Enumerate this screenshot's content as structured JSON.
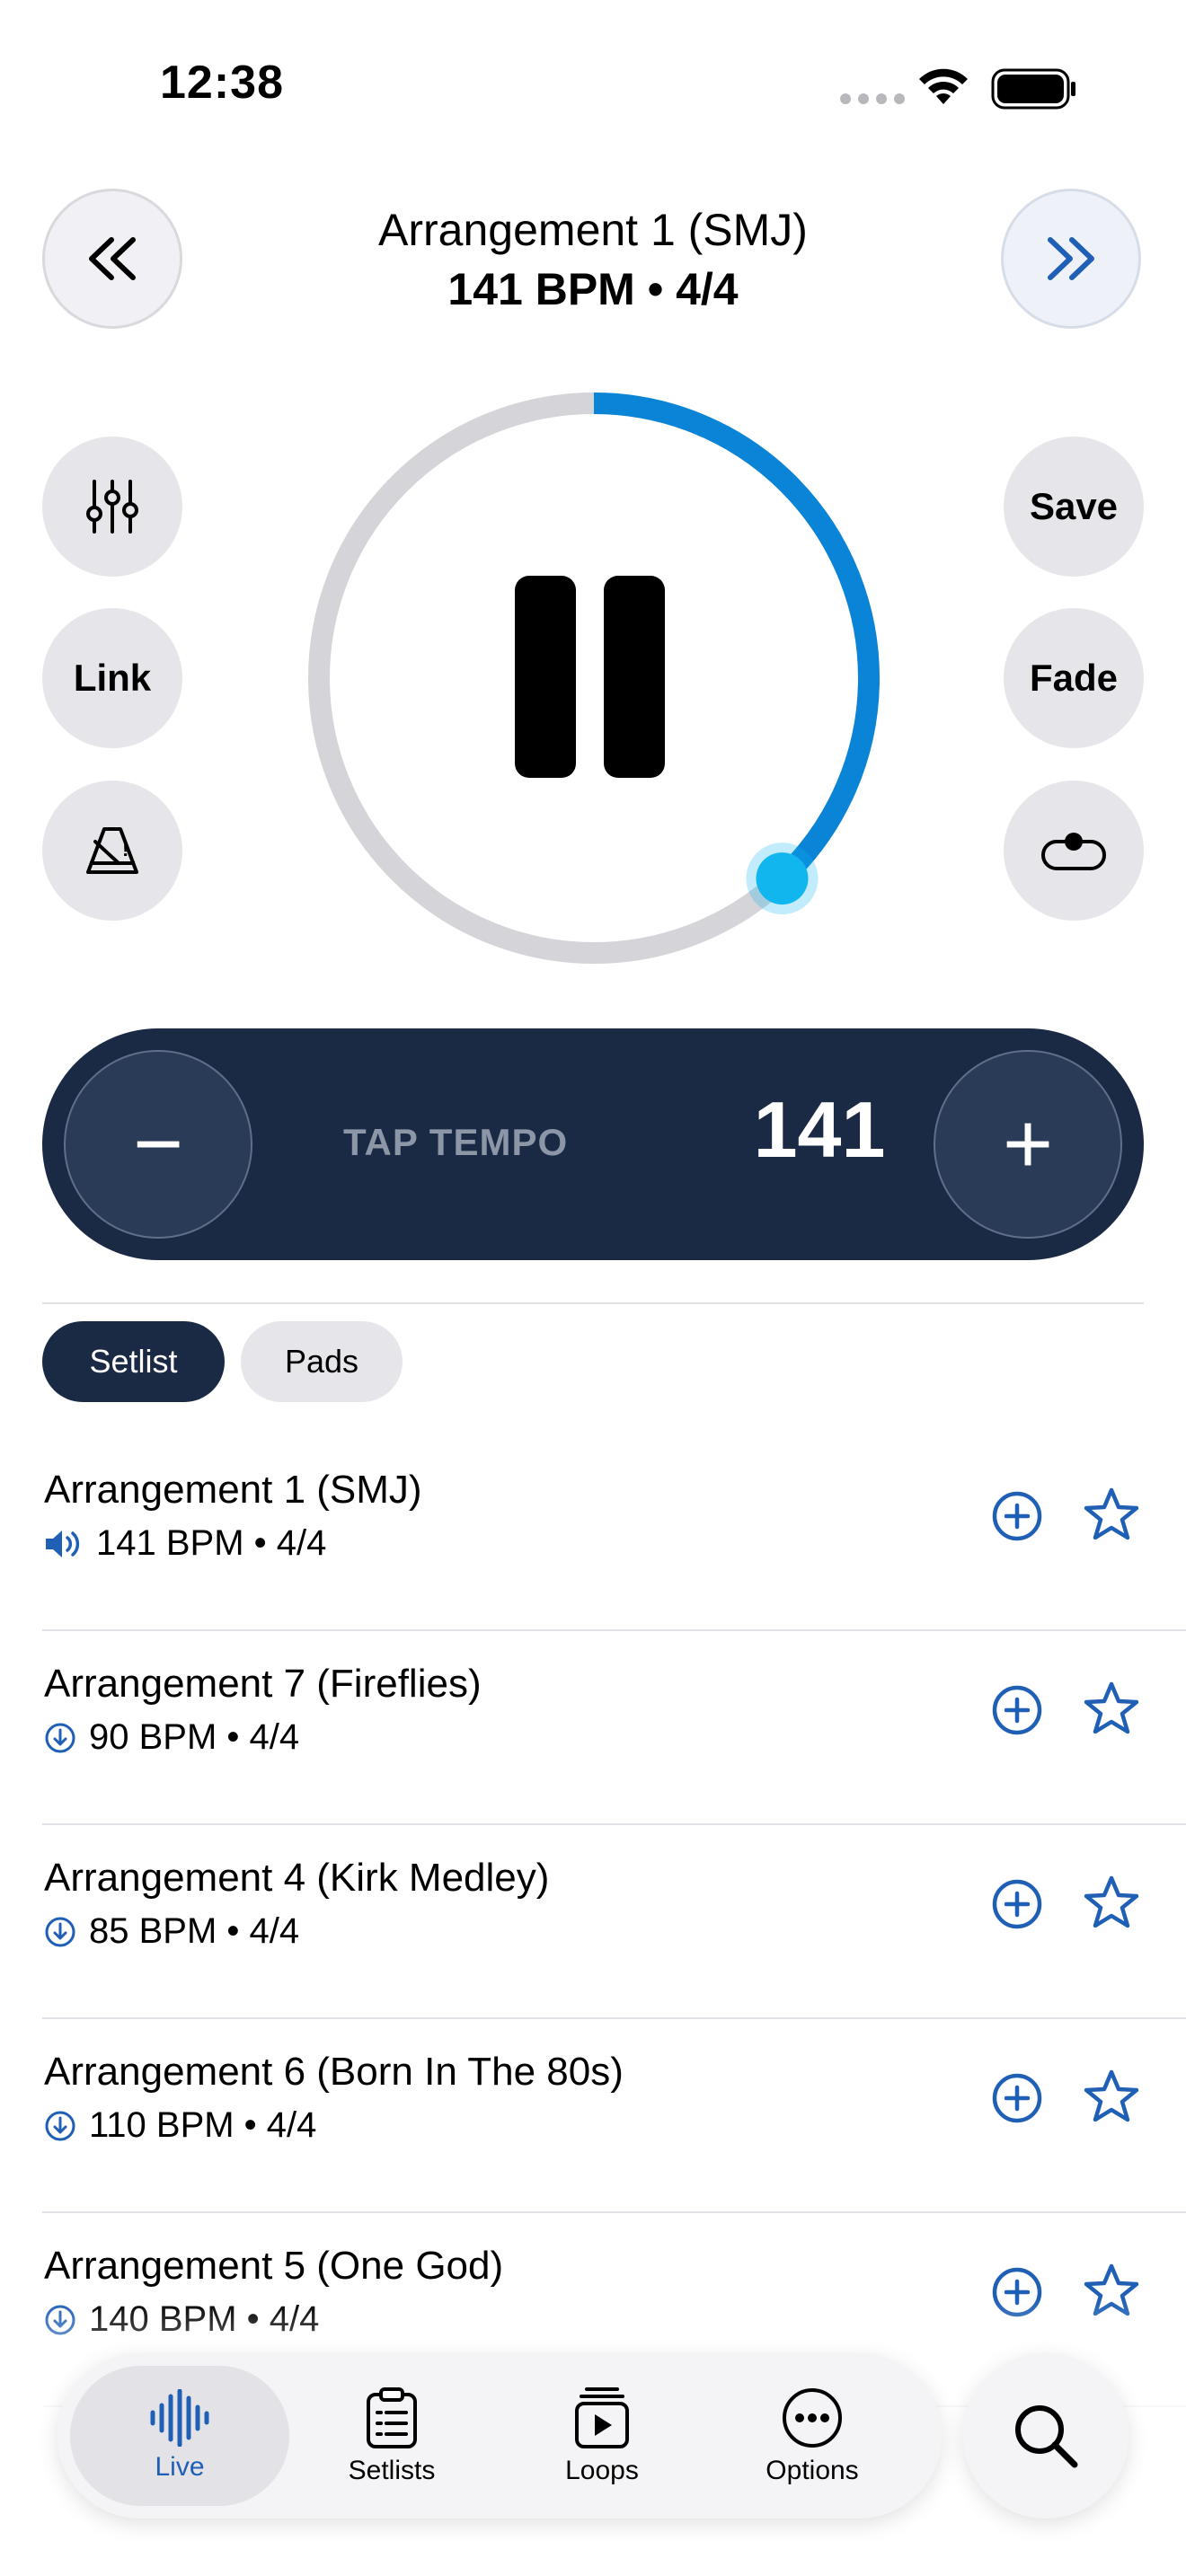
{
  "status_bar": {
    "time": "12:38"
  },
  "header": {
    "song_title": "Arrangement 1 (SMJ)",
    "song_meta": "141 BPM • 4/4"
  },
  "side_buttons": {
    "link_label": "Link",
    "save_label": "Save",
    "fade_label": "Fade"
  },
  "player": {
    "state": "playing",
    "progress": 0.38
  },
  "tempo": {
    "tap_label": "TAP TEMPO",
    "bpm": "141",
    "minus_symbol": "−",
    "plus_symbol": "+"
  },
  "segments": {
    "setlist": "Setlist",
    "pads": "Pads",
    "selected": "Setlist"
  },
  "setlist": [
    {
      "title": "Arrangement 1 (SMJ)",
      "meta": "141 BPM • 4/4",
      "status_icon": "speaker-icon"
    },
    {
      "title": "Arrangement 7 (Fireflies)",
      "meta": "90 BPM • 4/4",
      "status_icon": "download-icon"
    },
    {
      "title": "Arrangement 4 (Kirk Medley)",
      "meta": "85 BPM • 4/4",
      "status_icon": "download-icon"
    },
    {
      "title": "Arrangement 6 (Born In The 80s)",
      "meta": "110 BPM • 4/4",
      "status_icon": "download-icon"
    },
    {
      "title": "Arrangement 5 (One God)",
      "meta": "140 BPM • 4/4",
      "status_icon": "download-icon"
    }
  ],
  "tabbar": {
    "live": "Live",
    "setlists": "Setlists",
    "loops": "Loops",
    "options": "Options",
    "selected": "Live"
  },
  "colors": {
    "accent": "#0a84d6",
    "navy": "#1a2a45",
    "icon_blue": "#1f5fb5",
    "ring_track": "#d4d4d9"
  }
}
